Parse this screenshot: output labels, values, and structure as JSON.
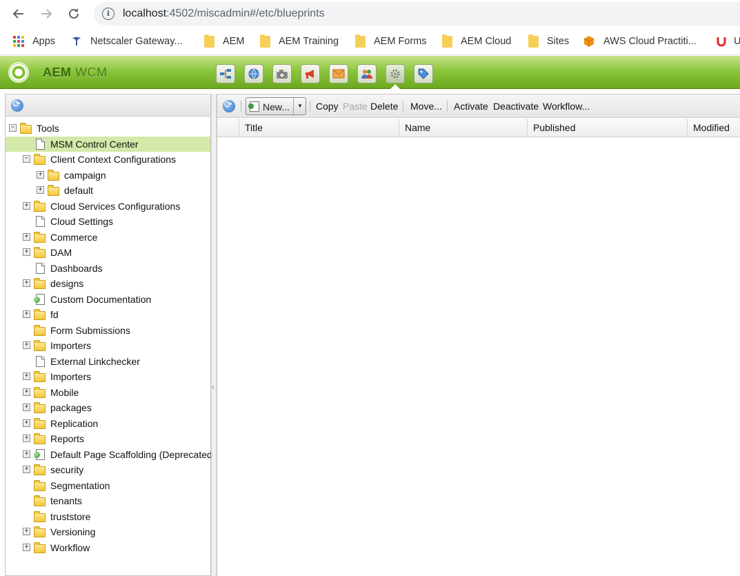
{
  "browser": {
    "url_host": "localhost",
    "url_rest": ":4502/miscadmin#/etc/blueprints",
    "bookmarks": [
      {
        "label": "Apps",
        "icon": "apps-grid-icon"
      },
      {
        "label": "Netscaler Gateway...",
        "icon": "tata-icon"
      },
      {
        "label": "AEM",
        "icon": "folder-icon"
      },
      {
        "label": "AEM Training",
        "icon": "folder-icon"
      },
      {
        "label": "AEM Forms",
        "icon": "folder-icon"
      },
      {
        "label": "AEM Cloud",
        "icon": "folder-icon"
      },
      {
        "label": "Sites",
        "icon": "folder-icon"
      },
      {
        "label": "AWS Cloud Practiti...",
        "icon": "aws-cube-icon"
      },
      {
        "label": "U",
        "icon": "udemy-icon"
      }
    ]
  },
  "header": {
    "title_bold": "AEM",
    "title_light": "WCM",
    "brand_color": "#8cc63e",
    "tools": [
      "sitemap-icon",
      "globe-icon",
      "camera-icon",
      "megaphone-icon",
      "mail-icon",
      "users-icon",
      "gears-icon",
      "tag-icon"
    ],
    "active_tool": "gears-icon"
  },
  "tree": {
    "items": [
      {
        "label": "Tools",
        "depth": 0,
        "type": "folder",
        "expander": "minus"
      },
      {
        "label": "MSM Control Center",
        "depth": 1,
        "type": "page",
        "expander": "none",
        "selected": true
      },
      {
        "label": "Client Context Configurations",
        "depth": 1,
        "type": "folder",
        "expander": "minus"
      },
      {
        "label": "campaign",
        "depth": 2,
        "type": "folder",
        "expander": "plus"
      },
      {
        "label": "default",
        "depth": 2,
        "type": "folder",
        "expander": "plus"
      },
      {
        "label": "Cloud Services Configurations",
        "depth": 1,
        "type": "folder",
        "expander": "plus"
      },
      {
        "label": "Cloud Settings",
        "depth": 1,
        "type": "page",
        "expander": "none"
      },
      {
        "label": "Commerce",
        "depth": 1,
        "type": "folder",
        "expander": "plus"
      },
      {
        "label": "DAM",
        "depth": 1,
        "type": "folder",
        "expander": "plus"
      },
      {
        "label": "Dashboards",
        "depth": 1,
        "type": "page",
        "expander": "none"
      },
      {
        "label": "designs",
        "depth": 1,
        "type": "folder",
        "expander": "plus"
      },
      {
        "label": "Custom Documentation",
        "depth": 1,
        "type": "webpage",
        "expander": "none"
      },
      {
        "label": "fd",
        "depth": 1,
        "type": "folder",
        "expander": "plus"
      },
      {
        "label": "Form Submissions",
        "depth": 1,
        "type": "folder",
        "expander": "none"
      },
      {
        "label": "Importers",
        "depth": 1,
        "type": "folder",
        "expander": "plus"
      },
      {
        "label": "External Linkchecker",
        "depth": 1,
        "type": "page",
        "expander": "none"
      },
      {
        "label": "Importers",
        "depth": 1,
        "type": "folder",
        "expander": "plus"
      },
      {
        "label": "Mobile",
        "depth": 1,
        "type": "folder",
        "expander": "plus"
      },
      {
        "label": "packages",
        "depth": 1,
        "type": "folder",
        "expander": "plus"
      },
      {
        "label": "Replication",
        "depth": 1,
        "type": "folder",
        "expander": "plus"
      },
      {
        "label": "Reports",
        "depth": 1,
        "type": "folder",
        "expander": "plus"
      },
      {
        "label": "Default Page Scaffolding (Deprecated)",
        "depth": 1,
        "type": "webpage",
        "expander": "plus"
      },
      {
        "label": "security",
        "depth": 1,
        "type": "folder",
        "expander": "plus"
      },
      {
        "label": "Segmentation",
        "depth": 1,
        "type": "folder",
        "expander": "none"
      },
      {
        "label": "tenants",
        "depth": 1,
        "type": "folder",
        "expander": "none"
      },
      {
        "label": "truststore",
        "depth": 1,
        "type": "folder",
        "expander": "none"
      },
      {
        "label": "Versioning",
        "depth": 1,
        "type": "folder",
        "expander": "plus"
      },
      {
        "label": "Workflow",
        "depth": 1,
        "type": "folder",
        "expander": "plus"
      }
    ]
  },
  "toolbar": {
    "new_label": "New...",
    "copy": "Copy",
    "paste": "Paste",
    "delete": "Delete",
    "move": "Move...",
    "activate": "Activate",
    "deactivate": "Deactivate",
    "workflow": "Workflow..."
  },
  "grid": {
    "columns": [
      "Title",
      "Name",
      "Published",
      "Modified"
    ]
  }
}
